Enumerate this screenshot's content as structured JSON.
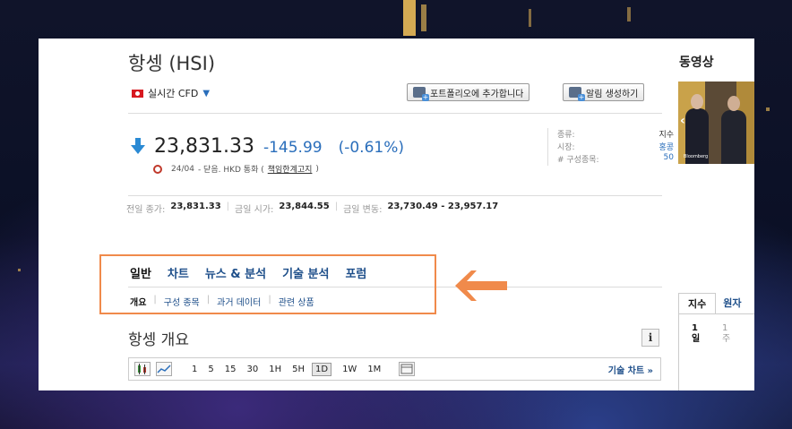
{
  "header": {
    "title": "항셍 (HSI)",
    "realtime_label": "실시간 CFD",
    "add_portfolio_label": "포트폴리오에 추가합니다",
    "create_alert_label": "알림 생성하기"
  },
  "quote": {
    "price": "23,831.33",
    "change": "-145.99",
    "change_pct": "(-0.61%)",
    "date": "24/04",
    "status": "- 닫음. HKD 통화 (",
    "disclaimer_link": "책임한계고지",
    "status_tail": ")"
  },
  "info": [
    {
      "key": "종류:",
      "value": "지수"
    },
    {
      "key": "시장:",
      "value": "홍콩"
    },
    {
      "key": "# 구성종목:",
      "value": "50"
    }
  ],
  "stats": {
    "prev_close_label": "전일 종가:",
    "prev_close": "23,831.33",
    "open_label": "금일 시가:",
    "open": "23,844.55",
    "range_label": "금일 변동:",
    "range": "23,730.49 - 23,957.17"
  },
  "tabs": [
    "일반",
    "차트",
    "뉴스 & 분석",
    "기술 분석",
    "포럼"
  ],
  "subtabs": [
    "개요",
    "구성 종목",
    "과거 데이터",
    "관련 상품"
  ],
  "overview_title": "항셍 개요",
  "info_button": "i",
  "toolbar": {
    "periods": [
      "1",
      "5",
      "15",
      "30",
      "1H",
      "5H",
      "1D",
      "1W",
      "1M"
    ],
    "selected_period": "1D",
    "tech_chart_label": "기술 차트 »"
  },
  "sidebar": {
    "video_title": "동영상",
    "video_prev": "‹",
    "video_brand": "Bloomberg",
    "tab_index": "지수",
    "tab_raw": "원자",
    "period_a": "1일",
    "period_b": "1주"
  },
  "colors": {
    "accent_blue": "#2a6ebb",
    "highlight_orange": "#f08a4b"
  }
}
